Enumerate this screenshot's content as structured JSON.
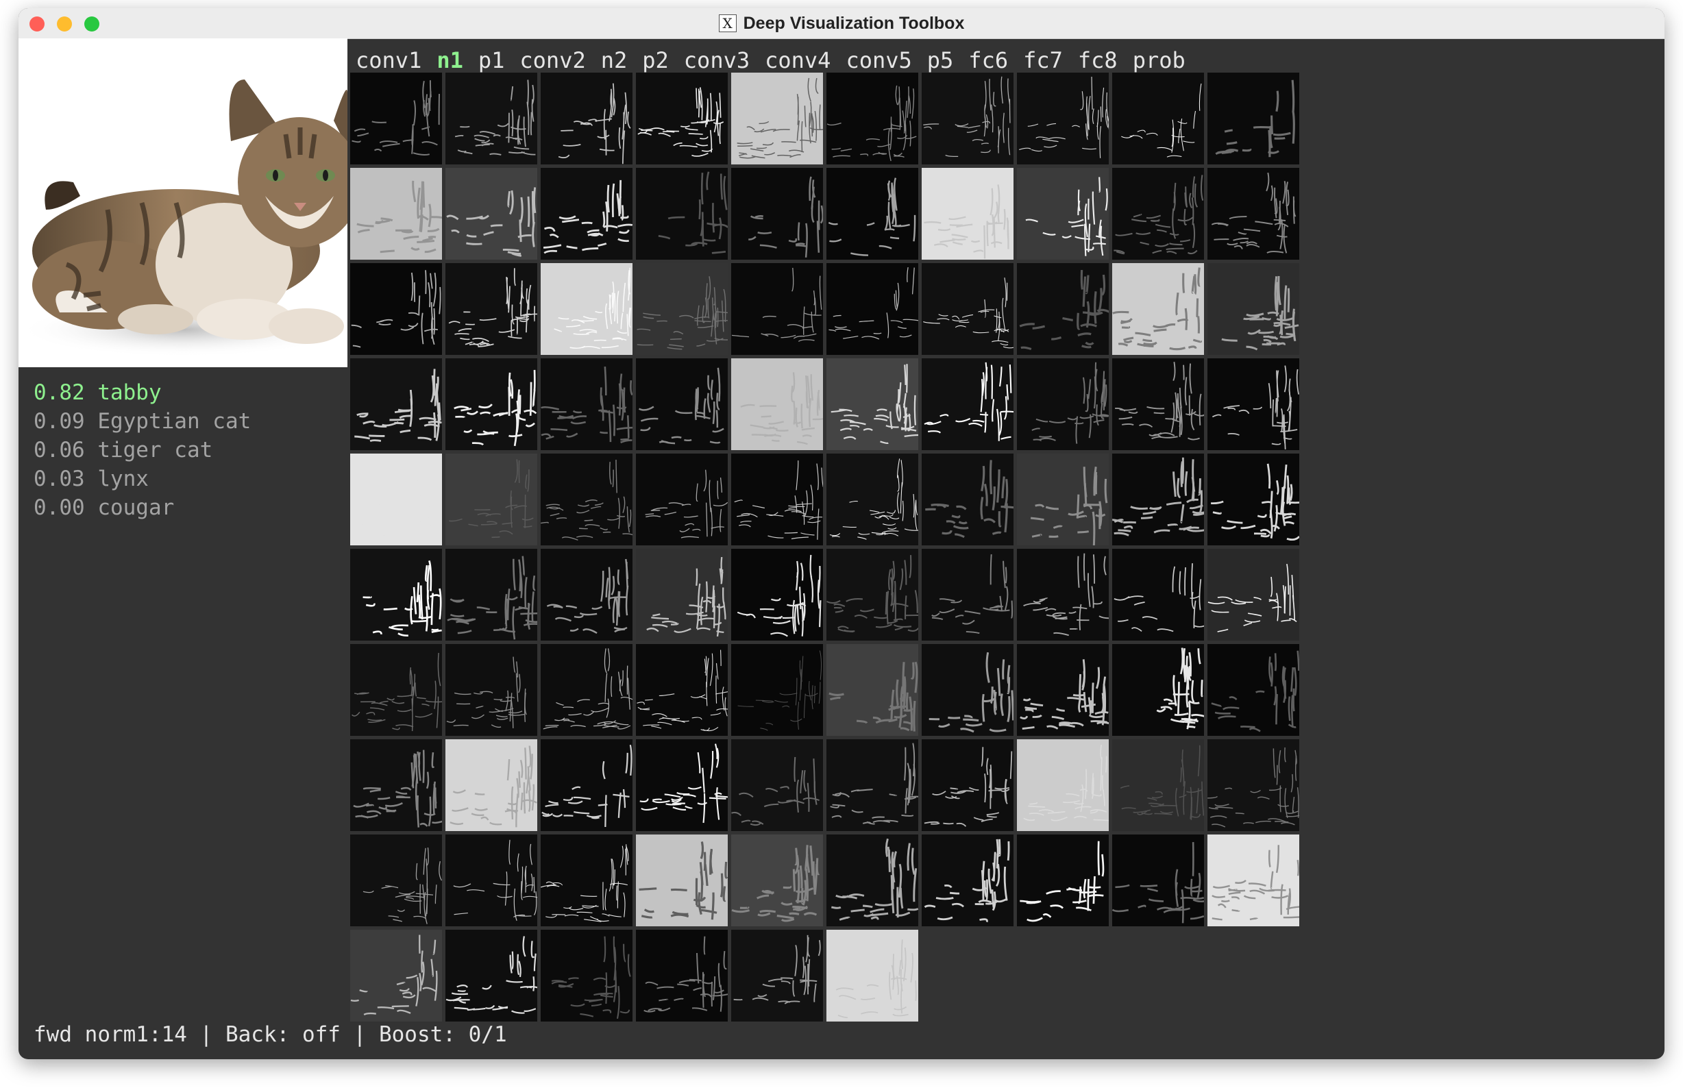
{
  "window": {
    "title": "Deep Visualization Toolbox",
    "x_icon": "x11-app-icon"
  },
  "layers": [
    "conv1",
    "n1",
    "p1",
    "conv2",
    "n2",
    "p2",
    "conv3",
    "conv4",
    "conv5",
    "p5",
    "fc6",
    "fc7",
    "fc8",
    "prob"
  ],
  "active_layer": "n1",
  "predictions": [
    {
      "text": "0.82 tabby"
    },
    {
      "text": "0.09 Egyptian cat"
    },
    {
      "text": "0.06 tiger cat"
    },
    {
      "text": "0.03 lynx"
    },
    {
      "text": "0.00 cougar"
    }
  ],
  "status": {
    "mode": "fwd norm1:14",
    "sep": "|",
    "back": "Back: off",
    "boost": "Boost: 0/1"
  },
  "grid": {
    "columns": 10,
    "tile_count": 96
  }
}
